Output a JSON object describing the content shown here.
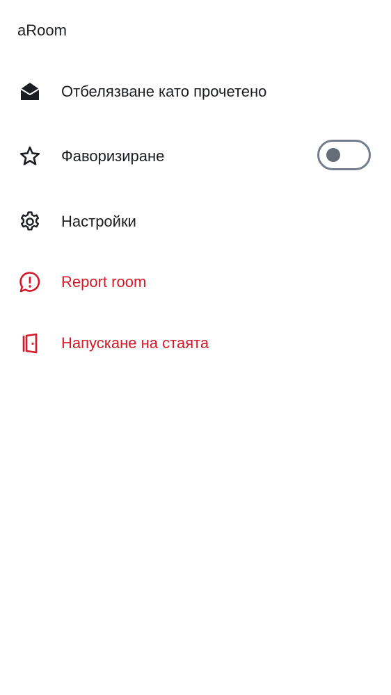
{
  "room": {
    "title": "aRoom"
  },
  "menu": {
    "mark_read": {
      "label": "Отбелязване като прочетено",
      "icon": "envelope-open-icon"
    },
    "favourite": {
      "label": "Фаворизиране",
      "icon": "star-icon",
      "toggle_on": false
    },
    "settings": {
      "label": "Настройки",
      "icon": "gear-icon"
    },
    "report": {
      "label": "Report room",
      "icon": "report-chat-icon"
    },
    "leave": {
      "label": "Напускане на стаята",
      "icon": "leave-door-icon"
    }
  },
  "colors": {
    "text": "#1b1d22",
    "danger": "#d51928",
    "toggle_border": "#737d8c",
    "toggle_knob": "#656d77",
    "background": "#ffffff"
  }
}
